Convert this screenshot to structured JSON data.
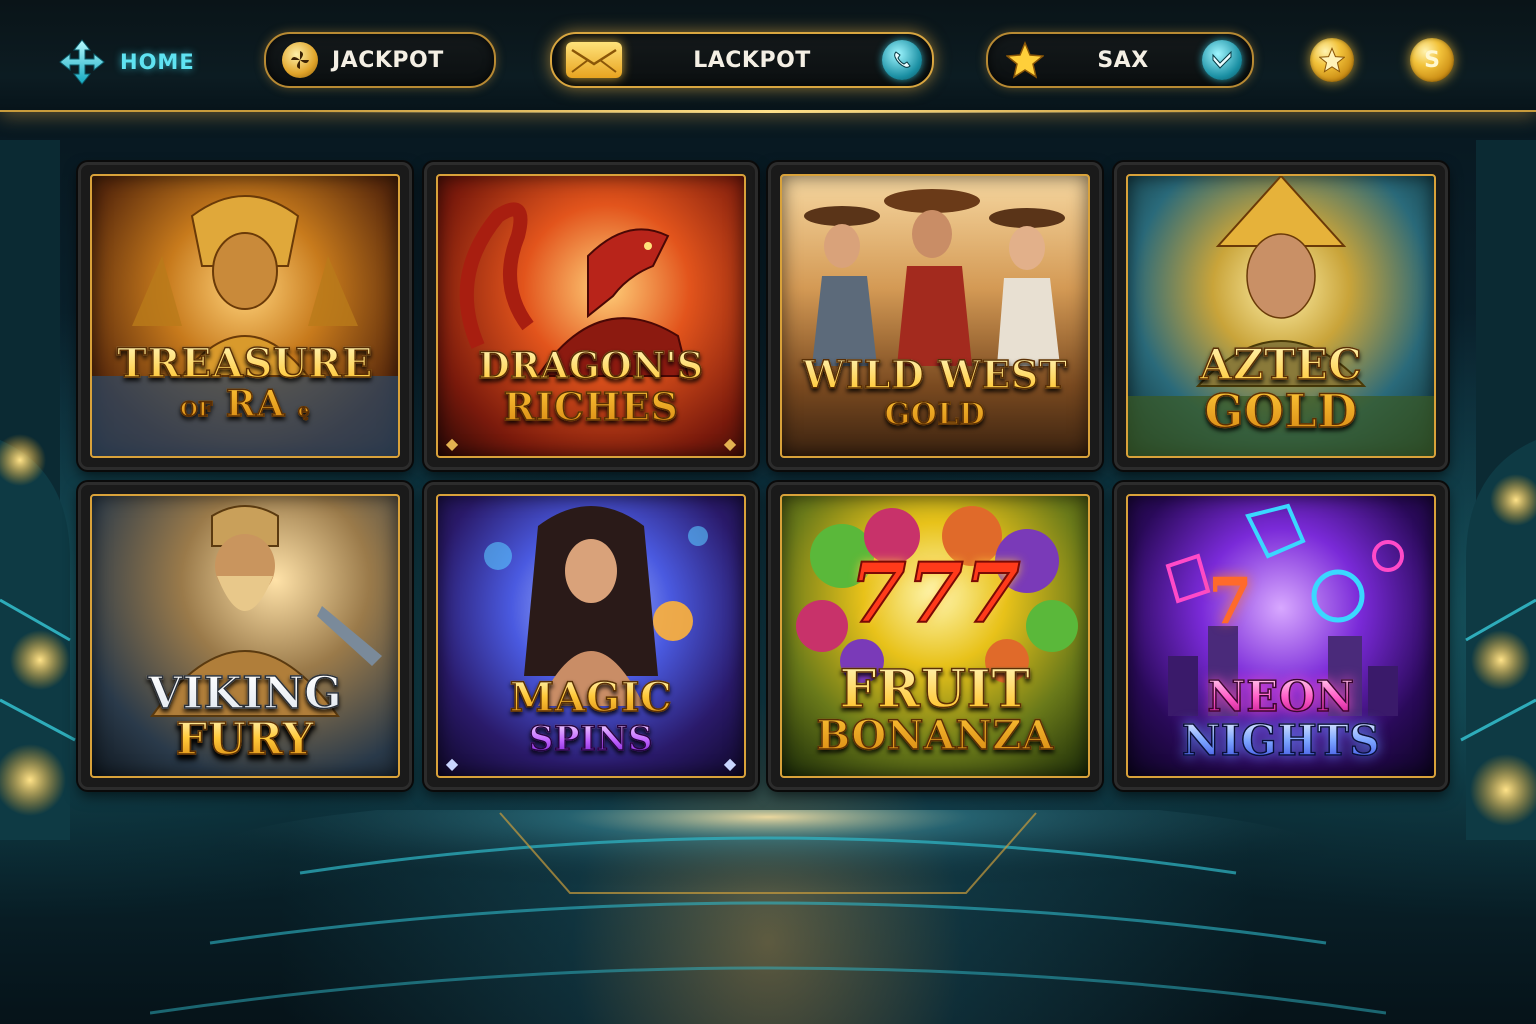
{
  "nav": {
    "home_label": "HOME",
    "jackpot_label": "JACKPOT",
    "lackpot_label": "LACKPOT",
    "sax_label": "SAX",
    "coin_icons": [
      "star-coin-icon",
      "s-coin-icon"
    ],
    "coin_s_glyph": "S",
    "icons": {
      "home": "plus-arrow-icon",
      "jackpot": "pinwheel-icon",
      "lackpot_left": "envelope-icon",
      "lackpot_right": "phone-icon",
      "sax_left": "star-icon",
      "sax_right": "check-heart-icon"
    }
  },
  "colors": {
    "accent_gold": "#d9a23a",
    "accent_cyan": "#5fe3f2",
    "background": "#0a2430"
  },
  "games": [
    {
      "line1": "TREASURE",
      "line2_small": "OF",
      "line2": "RA",
      "suffix": "ę",
      "theme": "egyptian"
    },
    {
      "line1": "DRAGON'S",
      "line2": "RICHES",
      "theme": "dragon"
    },
    {
      "line1": "WILD WEST",
      "line2": "GOLD",
      "theme": "western"
    },
    {
      "line1": "AZTEC",
      "line2": "GOLD",
      "theme": "aztec"
    },
    {
      "line1": "VIKING",
      "line2": "FURY",
      "theme": "viking"
    },
    {
      "line1": "MAGIC",
      "line2": "SPINS",
      "theme": "magic"
    },
    {
      "line1": "FRUIT",
      "line2": "BONANZA",
      "badge": "777",
      "theme": "fruit"
    },
    {
      "line1": "NEON",
      "line2": "NIGHTS",
      "badge": "7",
      "theme": "neon"
    }
  ]
}
